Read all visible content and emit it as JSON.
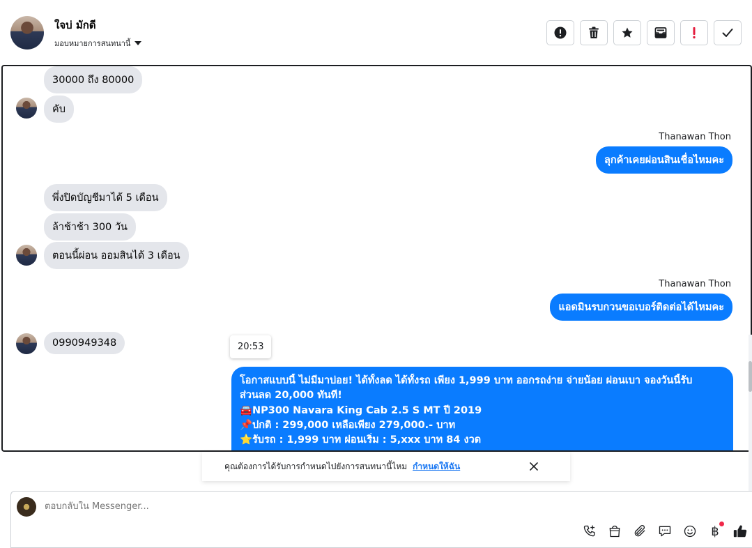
{
  "header": {
    "contact_name": "ใจบ่ มักดี",
    "assign_label": "มอบหมายการสนทนานี้",
    "actions": [
      {
        "name": "report-spam-button",
        "icon": "alert-circle-icon"
      },
      {
        "name": "delete-button",
        "icon": "trash-icon"
      },
      {
        "name": "star-button",
        "icon": "star-icon"
      },
      {
        "name": "mark-unread-button",
        "icon": "envelope-icon"
      },
      {
        "name": "mark-priority-button",
        "icon": "exclamation-icon"
      },
      {
        "name": "mark-done-button",
        "icon": "check-icon"
      }
    ]
  },
  "conversation": {
    "messages": {
      "in_1": "30000 ถึง 80000",
      "in_2": "คับ",
      "out_sender_1": "Thanawan Thon",
      "out_1": "ลุกค้าเคยผ่อนสินเชื่อไหมคะ",
      "in_3": "พึ่งปิดบัญชีมาได้ 5 เดือน",
      "in_4": "ล้าช้าช้า 300 วัน",
      "in_5": "ตอนนี้ผ่อน ออมสินได้ 3 เดือน",
      "out_sender_2": "Thanawan Thon",
      "out_2": "แอดมินรบกวนขอเบอร์ติดต่อได้ไหมคะ",
      "in_6": "0990949348"
    },
    "timestamp": "20:53",
    "long_message": {
      "line_1": "โอกาสแบบนี้ ไม่มีมาบ่อย! ได้ทั้งลด ได้ทั้งรถ เพียง 1,999 บาท ออกรถง่าย จ่ายน้อย ผ่อนเบา จองวันนี้รับ",
      "line_2": "ส่วนลด 20,000 ทันที!",
      "line_3_emoji": "🚘",
      "line_3": "NP300 Navara King Cab 2.5 S MT ปี 2019",
      "line_4_emoji": "📌",
      "line_4": "ปกติ : 299,000 เหลือเพียง 279,000.- บาท",
      "line_5_emoji": "⭐",
      "line_5": "รับรถ : 1,999 บาท ผ่อนเริ่ม : 5,xxx บาท 84 งวด"
    }
  },
  "notice": {
    "text": "คุณต้องการได้รับการกำหนดไปยังการสนทนานี้ไหม",
    "link": "กำหนดให้ฉัน"
  },
  "composer": {
    "placeholder": "ตอบกลับใน Messenger...",
    "currency_symbol": "฿"
  },
  "colors": {
    "outgoing_bubble": "#0a7cff",
    "incoming_bubble": "#e4e6eb",
    "priority_red": "#e41e3f",
    "link_blue": "#1876f2"
  }
}
